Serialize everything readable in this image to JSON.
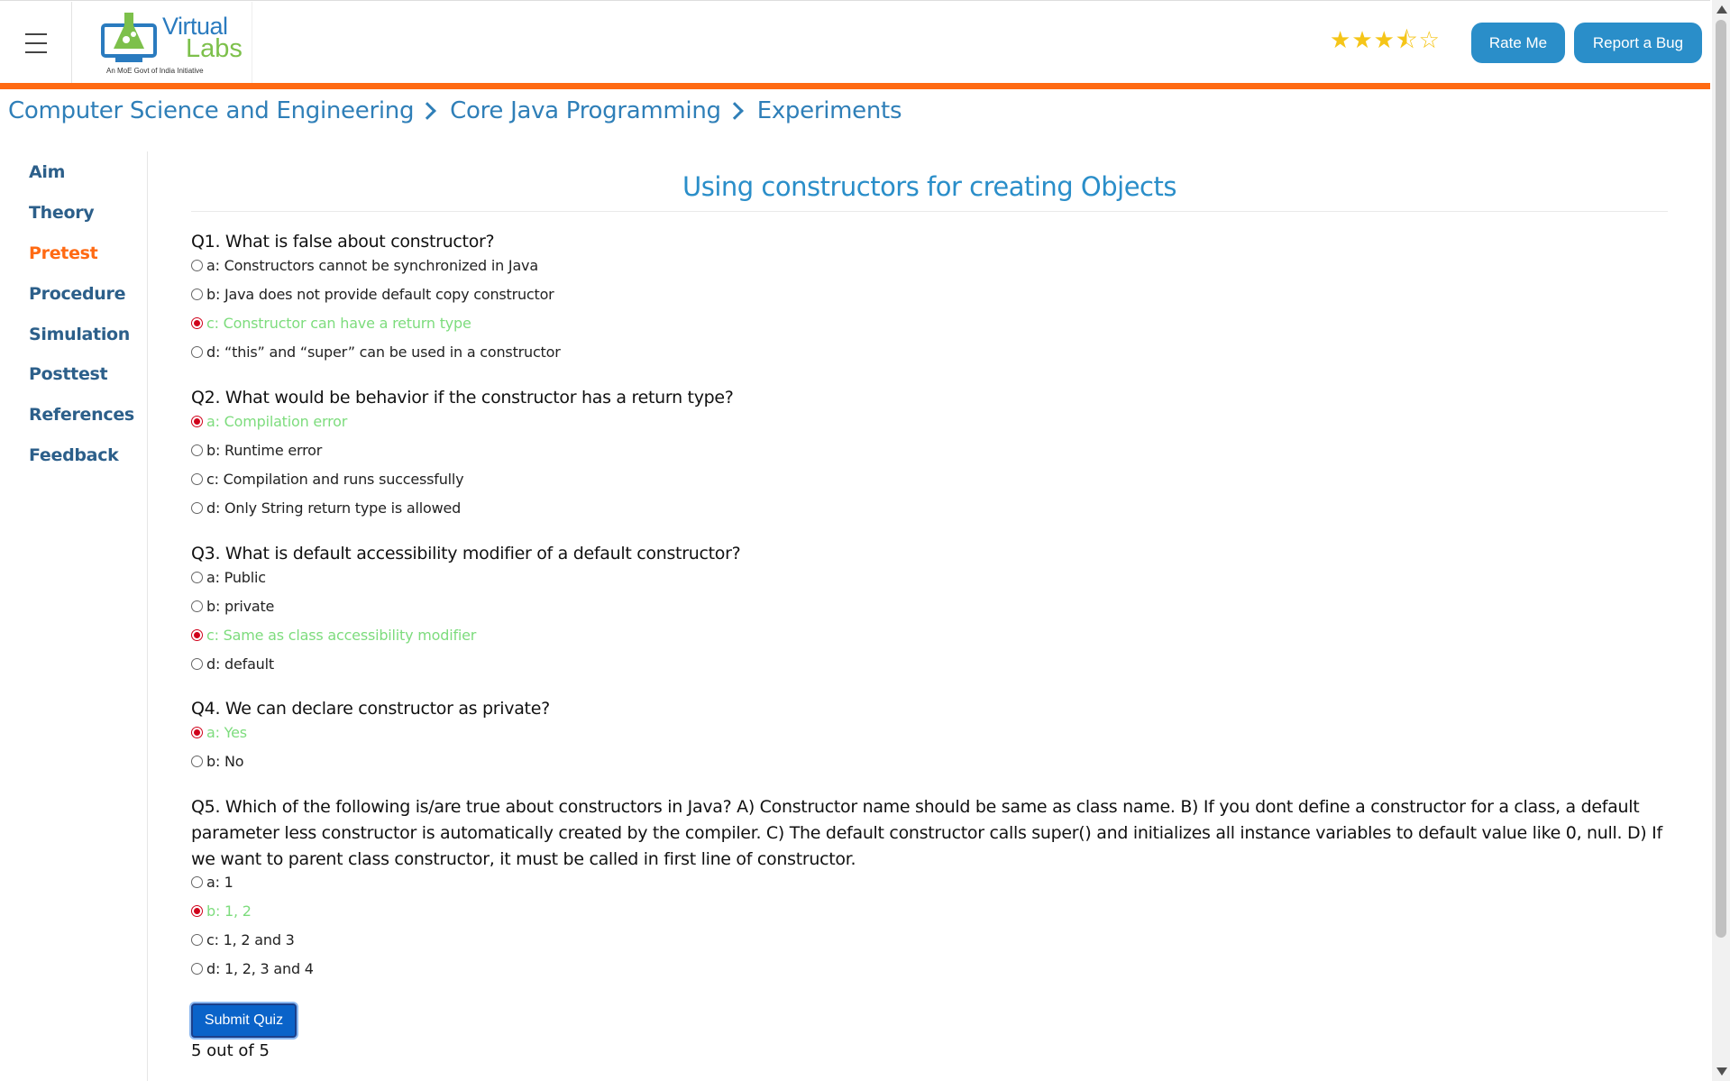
{
  "header": {
    "logo_top": "Virtual",
    "logo_bottom": "Labs",
    "logo_tagline": "An MoE Govt of India Initiative",
    "rating": 3.5,
    "rate_label": "Rate Me",
    "bug_label": "Report a Bug",
    "accent_color": "#ff6a13",
    "brand_color": "#2a8ec9"
  },
  "breadcrumb": [
    "Computer Science and Engineering",
    "Core Java Programming",
    "Experiments"
  ],
  "sidebar": {
    "items": [
      {
        "label": "Aim",
        "active": false
      },
      {
        "label": "Theory",
        "active": false
      },
      {
        "label": "Pretest",
        "active": true
      },
      {
        "label": "Procedure",
        "active": false
      },
      {
        "label": "Simulation",
        "active": false
      },
      {
        "label": "Posttest",
        "active": false
      },
      {
        "label": "References",
        "active": false
      },
      {
        "label": "Feedback",
        "active": false
      }
    ]
  },
  "main": {
    "title": "Using constructors for creating Objects",
    "questions": [
      {
        "text": "Q1. What is false about constructor?",
        "options": [
          {
            "label": "a: Constructors cannot be synchronized in Java",
            "checked": false,
            "correct": false
          },
          {
            "label": "b: Java does not provide default copy constructor",
            "checked": false,
            "correct": false
          },
          {
            "label": "c: Constructor can have a return type",
            "checked": true,
            "correct": true
          },
          {
            "label": "d: “this” and “super” can be used in a constructor",
            "checked": false,
            "correct": false
          }
        ]
      },
      {
        "text": "Q2. What would be behavior if the constructor has a return type?",
        "options": [
          {
            "label": "a: Compilation error",
            "checked": true,
            "correct": true
          },
          {
            "label": "b: Runtime error",
            "checked": false,
            "correct": false
          },
          {
            "label": "c: Compilation and runs successfully",
            "checked": false,
            "correct": false
          },
          {
            "label": "d: Only String return type is allowed",
            "checked": false,
            "correct": false
          }
        ]
      },
      {
        "text": "Q3. What is default accessibility modifier of a default constructor?",
        "options": [
          {
            "label": "a: Public",
            "checked": false,
            "correct": false
          },
          {
            "label": "b: private",
            "checked": false,
            "correct": false
          },
          {
            "label": "c: Same as class accessibility modifier",
            "checked": true,
            "correct": true
          },
          {
            "label": "d: default",
            "checked": false,
            "correct": false
          }
        ]
      },
      {
        "text": "Q4. We can declare constructor as private?",
        "options": [
          {
            "label": "a: Yes",
            "checked": true,
            "correct": true
          },
          {
            "label": "b: No",
            "checked": false,
            "correct": false
          }
        ]
      },
      {
        "text": "Q5. Which of the following is/are true about constructors in Java? A) Constructor name should be same as class name. B) If you dont define a constructor for a class, a default parameter less constructor is automatically created by the compiler. C) The default constructor calls super() and initializes all instance variables to default value like 0, null. D) If we want to parent class constructor, it must be called in first line of constructor.",
        "options": [
          {
            "label": "a: 1",
            "checked": false,
            "correct": false
          },
          {
            "label": "b: 1, 2",
            "checked": true,
            "correct": true
          },
          {
            "label": "c: 1, 2 and 3",
            "checked": false,
            "correct": false
          },
          {
            "label": "d: 1, 2, 3 and 4",
            "checked": false,
            "correct": false
          }
        ]
      }
    ],
    "submit_label": "Submit Quiz",
    "score_text": "5 out of 5"
  }
}
